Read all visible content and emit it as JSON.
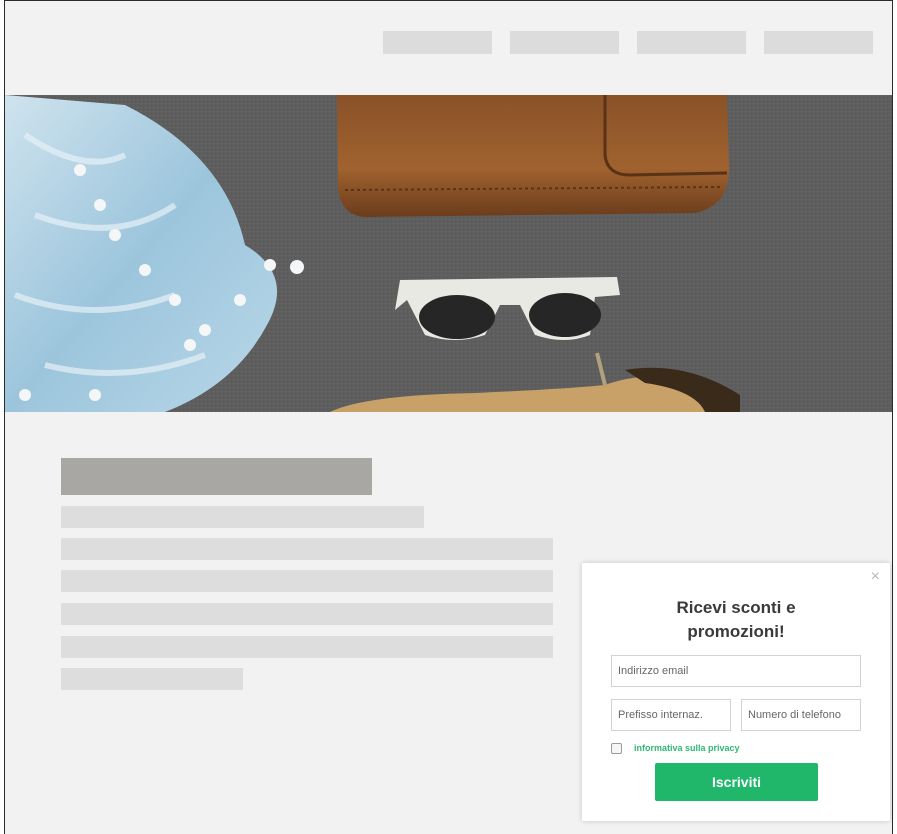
{
  "nav": {
    "items": [
      "",
      "",
      "",
      ""
    ]
  },
  "hero": {
    "image": "flat-lay-accessories"
  },
  "popup": {
    "close_icon": "×",
    "title_line1": "Ricevi sconti e",
    "title_line2": "promozioni!",
    "email_placeholder": "Indirizzo email",
    "prefix_placeholder": "Prefisso internaz.",
    "phone_placeholder": "Numero di telefono",
    "privacy_label": "informativa sulla privacy",
    "submit_label": "Iscriviti",
    "accent_color": "#20b76b"
  }
}
